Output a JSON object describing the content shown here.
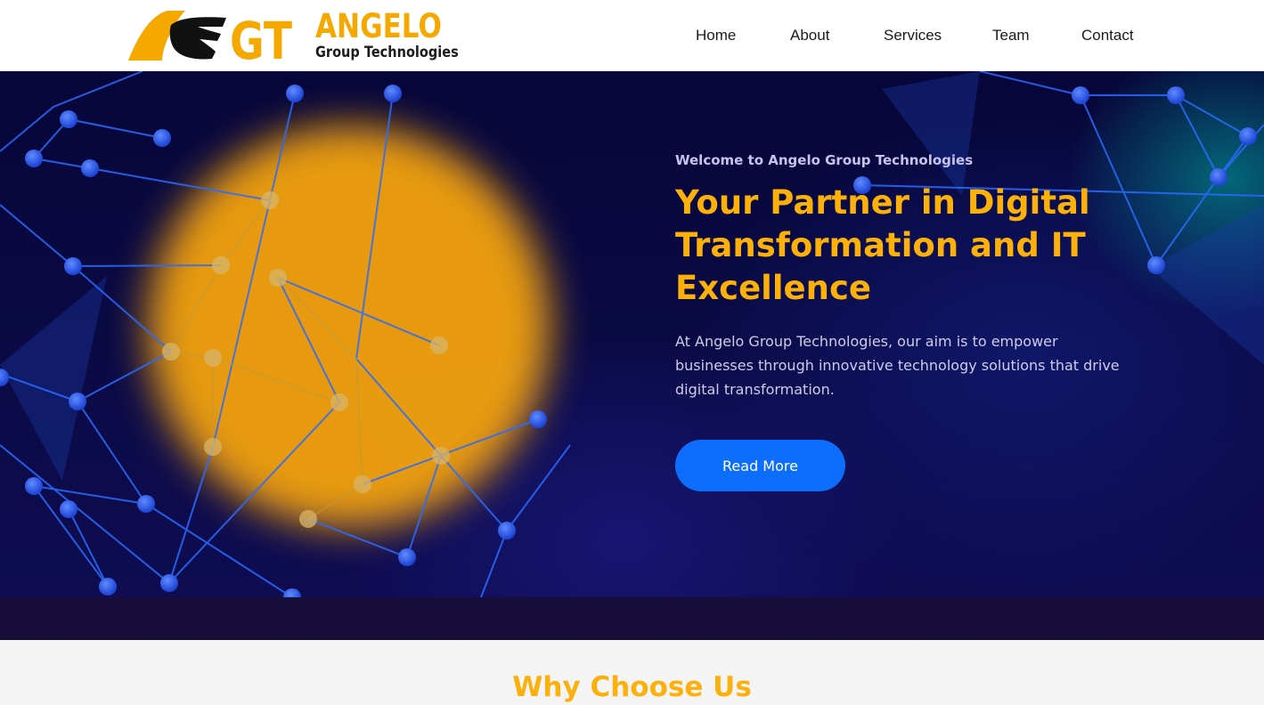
{
  "brand": {
    "mark_text": "GT",
    "name": "ANGELO",
    "tagline": "Group Technologies",
    "colors": {
      "accent": "#f5a800",
      "dark": "#1c1c1c"
    }
  },
  "nav": {
    "items": [
      {
        "label": "Home"
      },
      {
        "label": "About"
      },
      {
        "label": "Services"
      },
      {
        "label": "Team"
      },
      {
        "label": "Contact"
      }
    ]
  },
  "hero": {
    "welcome": "Welcome to Angelo Group Technologies",
    "headline": "Your Partner in Digital Transformation and IT Excellence",
    "lead": "At Angelo Group Technologies, our aim is to empower businesses through innovative technology solutions that drive digital transformation.",
    "cta_label": "Read More",
    "colors": {
      "headline": "#fbb00c",
      "cta": "#0d6efd",
      "background": "#07063a"
    }
  },
  "why_section": {
    "title": "Why Choose Us"
  }
}
